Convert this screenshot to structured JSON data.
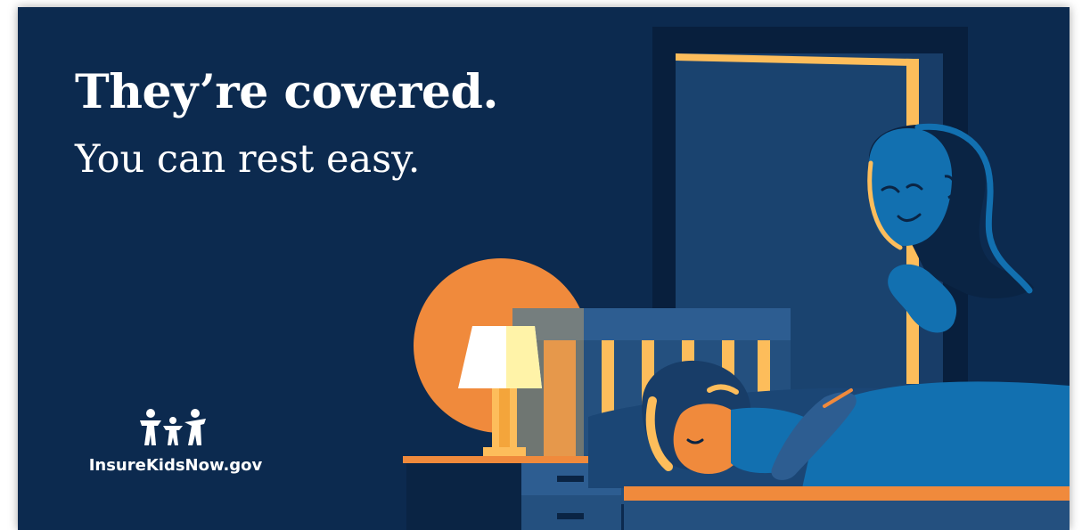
{
  "banner": {
    "headline": "They’re covered.",
    "subhead": "You can rest easy.",
    "colors": {
      "background": "#0c2a4f",
      "accent_orange": "#f08a3c",
      "accent_yellow": "#fdbd5b",
      "accent_blue": "#1270b0"
    }
  },
  "logo": {
    "text": "InsureKidsNow.gov",
    "icon": "family-icon"
  },
  "illustration": {
    "elements": [
      "lamp-icon",
      "nightstand",
      "bed",
      "sleeping-child",
      "smiling-parent",
      "open-door"
    ]
  }
}
